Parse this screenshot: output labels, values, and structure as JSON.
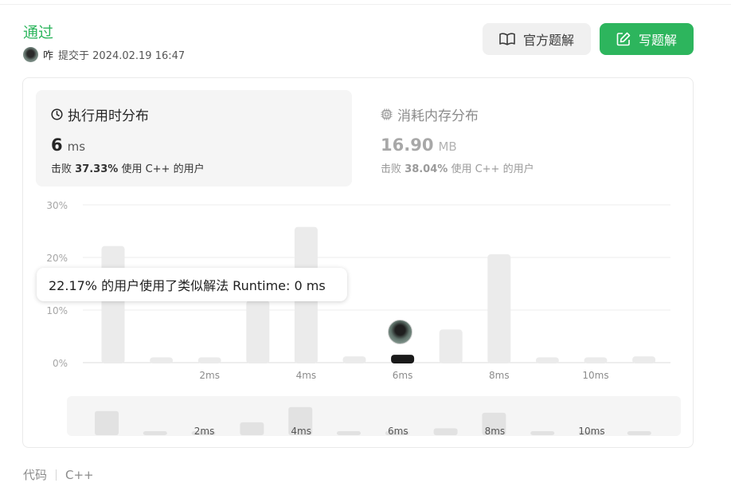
{
  "submission": {
    "status": "通过",
    "username": "咋",
    "submitted_text": "提交于 2024.02.19 16:47"
  },
  "buttons": {
    "official": "官方题解",
    "write": "写题解"
  },
  "tabs": {
    "runtime": {
      "title": "执行用时分布",
      "value": "6",
      "unit": "ms",
      "beat_prefix": "击败",
      "beat_pct": "37.33%",
      "beat_suffix": "使用 C++ 的用户"
    },
    "memory": {
      "title": "消耗内存分布",
      "value": "16.90",
      "unit": "MB",
      "beat_prefix": "击败",
      "beat_pct": "38.04%",
      "beat_suffix": "使用 C++ 的用户"
    }
  },
  "tooltip": "22.17% 的用户使用了类似解法 Runtime: 0 ms",
  "footer": {
    "code_label": "代码",
    "language": "C++"
  },
  "colors": {
    "accent_green": "#2db55d",
    "bar_gray": "#ebebeb",
    "bar_selected": "#1a1a1a"
  },
  "chart_data": {
    "type": "bar",
    "x_unit": "ms",
    "x": [
      0,
      1,
      2,
      3,
      4,
      5,
      6,
      7,
      8,
      9,
      10,
      11
    ],
    "values": [
      22.17,
      1.0,
      1.0,
      11.8,
      25.8,
      1.2,
      1.5,
      6.3,
      20.6,
      1.0,
      1.0,
      1.2
    ],
    "selected_x": 6,
    "y_ticks": [
      "30%",
      "20%",
      "10%",
      "0%"
    ],
    "y_tick_values": [
      30,
      20,
      10,
      0
    ],
    "ylim": [
      0,
      30
    ],
    "x_tick_labels": [
      "2ms",
      "4ms",
      "6ms",
      "8ms",
      "10ms"
    ],
    "x_tick_values": [
      2,
      4,
      6,
      8,
      10
    ],
    "grid": true,
    "overview": {
      "x_tick_labels": [
        "2ms",
        "4ms",
        "6ms",
        "8ms",
        "10ms"
      ]
    }
  }
}
